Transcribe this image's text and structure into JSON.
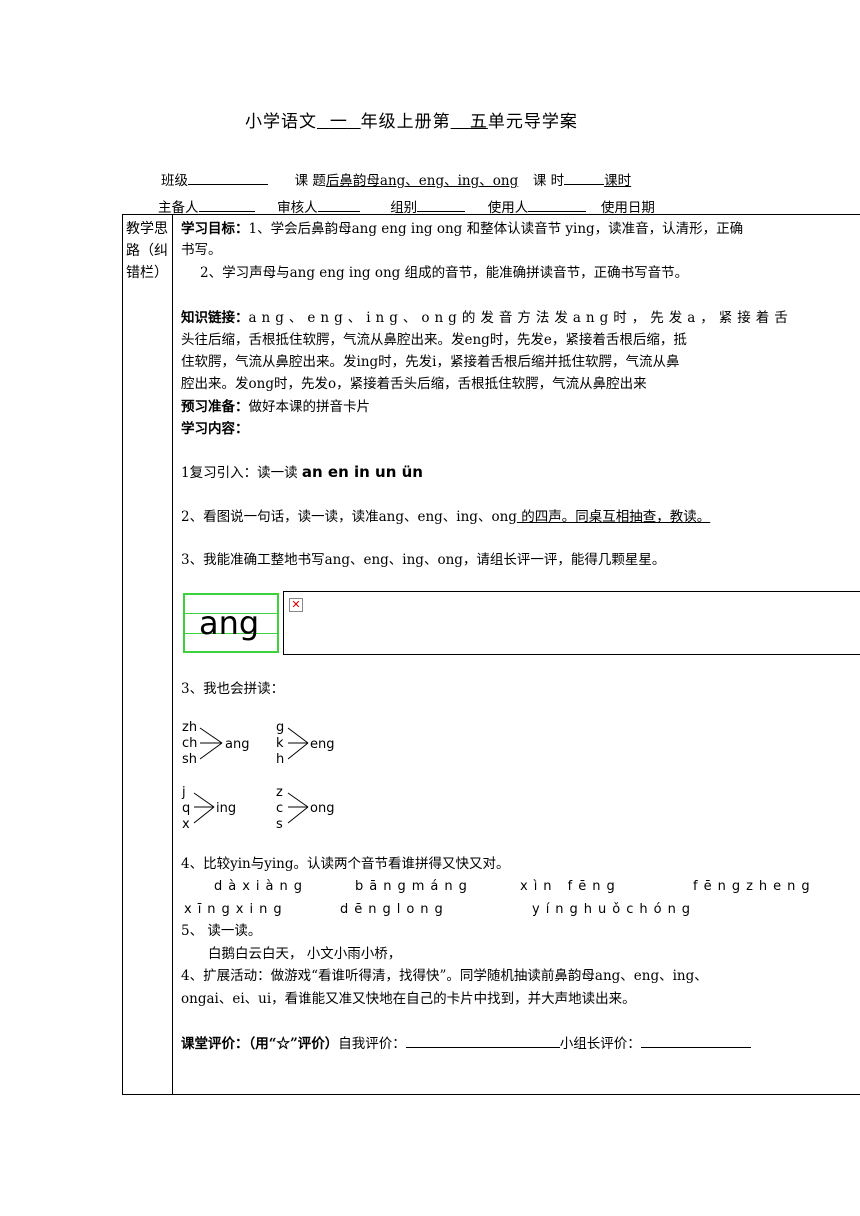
{
  "title": {
    "prefix": "小学语文",
    "grade": "一",
    "mid": "年级上册第",
    "unit": "五",
    "suffix": "单元导学案"
  },
  "header": {
    "class_label": "班级",
    "topic_label": "课 题",
    "topic_value": "后鼻韵母ang、eng、ing、ong",
    "period_label": "课 时",
    "period_unit": "课时",
    "preparer_label": "主备人",
    "reviewer_label": "审核人",
    "group_label": "组别",
    "user_label": "使用人",
    "date_label": "使用日期"
  },
  "sidebar": {
    "label": "教学思路（纠错栏）"
  },
  "content": {
    "goal_label": "学习目标：",
    "goal_1": "1、学会后鼻韵母ang eng ing ong 和整体认读音节 ying，读准音，认清形，正确",
    "goal_1b": "书写。",
    "goal_2": "2、学习声母与ang eng ing ong 组成的音节，能准确拼读音节，正确书写音节。",
    "knowledge_label": "知识链接：",
    "knowledge_1": "ang、eng、ing、ong的发音方法发ang时，先发a，紧接着舌",
    "knowledge_2": "头往后缩，舌根抵住软腭，气流从鼻腔出来。发eng时，先发e，紧接着舌根后缩，抵",
    "knowledge_3": "住软腭，气流从鼻腔出来。发ing时，先发i，紧接着舌根后缩并抵住软腭，气流从鼻",
    "knowledge_4": "腔出来。发ong时，先发o，紧接着舌头后缩，舌根抵住软腭，气流从鼻腔出来",
    "prep_label": "预习准备：",
    "prep_text": "做好本课的拼音卡片",
    "content_label": "学习内容：",
    "item1_prefix": "1复习引入：读一读 ",
    "item1_pinyin": "an en in un ün",
    "item2_prefix": "2、看图说一句话，读一读，读准ang、eng、ing、ong",
    "item2_underlined": "  的四声。同桌互相抽查，教读。",
    "item3": "3、我能准确工整地书写ang、eng、ing、ong，请组长评一评，能得几颗星星。",
    "writing_sample": "ang",
    "broken_image_icon": "broken-image-icon",
    "item3b": "3、我也会拼读：",
    "spell_groups": [
      {
        "initials": [
          "zh",
          "ch",
          "sh"
        ],
        "final": "ang"
      },
      {
        "initials": [
          "g",
          "k",
          "h"
        ],
        "final": "eng"
      },
      {
        "initials": [
          "j",
          "q",
          "x"
        ],
        "final": "ing"
      },
      {
        "initials": [
          "z",
          "c",
          "s"
        ],
        "final": "ong"
      }
    ],
    "item4": "4、比较yin与ying。认读两个音节看谁拼得又快又对。",
    "words_row1": [
      "dàxiàng",
      "bāngmáng",
      "xìn fēng",
      "fēngzheng"
    ],
    "words_row2": [
      "xīngxing",
      "dēnglong",
      "yínghuǒchóng"
    ],
    "item5": "5、  读一读。",
    "read_line": "白鹅白云白天，    小文小雨小桥，",
    "item6_1": "4、扩展活动：做游戏“看谁听得清，找得快”。同学随机抽读前鼻韵母ang、eng、ing、",
    "item6_2": "ongai、ei、ui，看谁能又准又快地在自己的卡片中找到，并大声地读出来。",
    "eval_label": "课堂评价：（用“☆”评价）",
    "self_eval": "自我评价：",
    "leader_eval": "小组长评价："
  },
  "colors": {
    "grid_green": "#3cd23c"
  }
}
